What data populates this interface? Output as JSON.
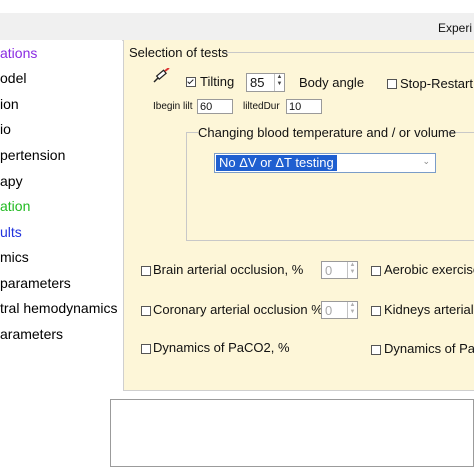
{
  "window": {
    "title": "Experi"
  },
  "sidebar": {
    "items": [
      {
        "label": "ations",
        "color": "#8a2be2"
      },
      {
        "label": "odel",
        "color": "#000000"
      },
      {
        "label": "ion",
        "color": "#000000"
      },
      {
        "label": "io",
        "color": "#000000"
      },
      {
        "label": "pertension",
        "color": "#000000"
      },
      {
        "label": "apy",
        "color": "#000000"
      },
      {
        "label": "ation",
        "color": "#22bb22"
      },
      {
        "label": "ults",
        "color": "#2233dd"
      },
      {
        "label": "mics",
        "color": "#000000"
      },
      {
        "label": " parameters",
        "color": "#000000"
      },
      {
        "label": "tral hemodynamics",
        "color": "#000000"
      },
      {
        "label": "arameters",
        "color": "#000000"
      }
    ]
  },
  "tests": {
    "legend": "Selection of tests",
    "tilting": {
      "label": "Tilting",
      "checked": true,
      "angle_value": "85",
      "angle_label": "Body angle",
      "begin_label": "Ibegin lilt",
      "begin_value": "60",
      "dur_label": "liltedDur",
      "dur_value": "10"
    },
    "stop_restart": {
      "label": "Stop-Restart H",
      "checked": false
    },
    "blood": {
      "legend": "Changing blood temperature and / or volume",
      "selected": "No ΔV or ΔT testing"
    },
    "brain": {
      "label": "Brain arterial occlusion, %",
      "value": "0"
    },
    "aerobic": {
      "label": "Aerobic exercise"
    },
    "coronary": {
      "label": "Coronary arterial occlusion %",
      "value": "0"
    },
    "kidneys": {
      "label": "Kidneys arterial"
    },
    "paco2": {
      "label": "Dynamics of PaCO2, %"
    },
    "dynamics_p": {
      "label": "Dynamics of  Pa"
    }
  },
  "colors": {
    "panel_bg": "#fdf6d8",
    "highlight": "#1f5fd0"
  },
  "icons": {
    "tilting": "syringe-icon"
  }
}
